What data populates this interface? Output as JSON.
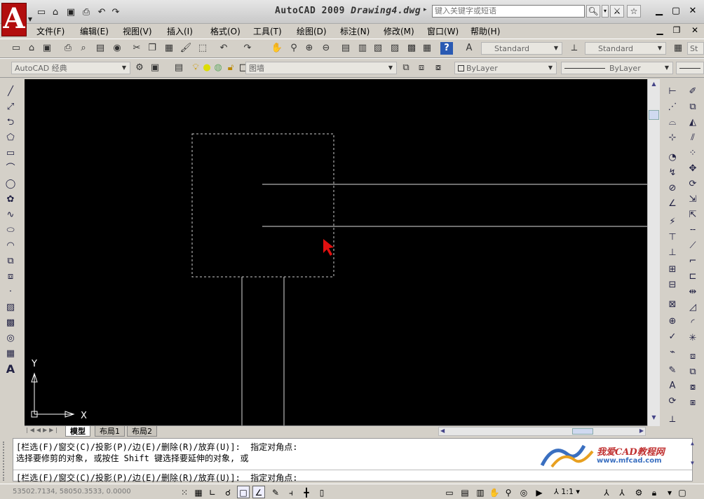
{
  "title": {
    "app": "AutoCAD 2009",
    "doc": "Drawing4.dwg",
    "search_placeholder": "键入关键字或短语"
  },
  "menus": [
    "文件(F)",
    "编辑(E)",
    "视图(V)",
    "插入(I)",
    "格式(O)",
    "工具(T)",
    "绘图(D)",
    "标注(N)",
    "修改(M)",
    "窗口(W)",
    "帮助(H)"
  ],
  "styles": {
    "text_style": "Standard",
    "dim_style": "Standard",
    "table_style": "St"
  },
  "workspace": "AutoCAD 经典",
  "layer": "图墙",
  "props": {
    "color": "ByLayer",
    "linetype": "ByLayer"
  },
  "tabs": [
    "模型",
    "布局1",
    "布局2"
  ],
  "command": {
    "line1": "[栏选(F)/窗交(C)/投影(P)/边(E)/删除(R)/放弃(U)]:  指定对角点:",
    "line2": "选择要修剪的对象, 或按住 Shift 键选择要延伸的对象, 或",
    "line3": "[栏选(F)/窗交(C)/投影(P)/边(E)/删除(R)/放弃(U)]:  指定对角点:"
  },
  "watermark": {
    "brand": "我爱CAD教程网",
    "url": "www.mfcad.com"
  },
  "status": {
    "coords": "53502.7134, 58050.3533, 0.0000",
    "scale": "1:1"
  },
  "ucs": {
    "x": "X",
    "y": "Y"
  }
}
